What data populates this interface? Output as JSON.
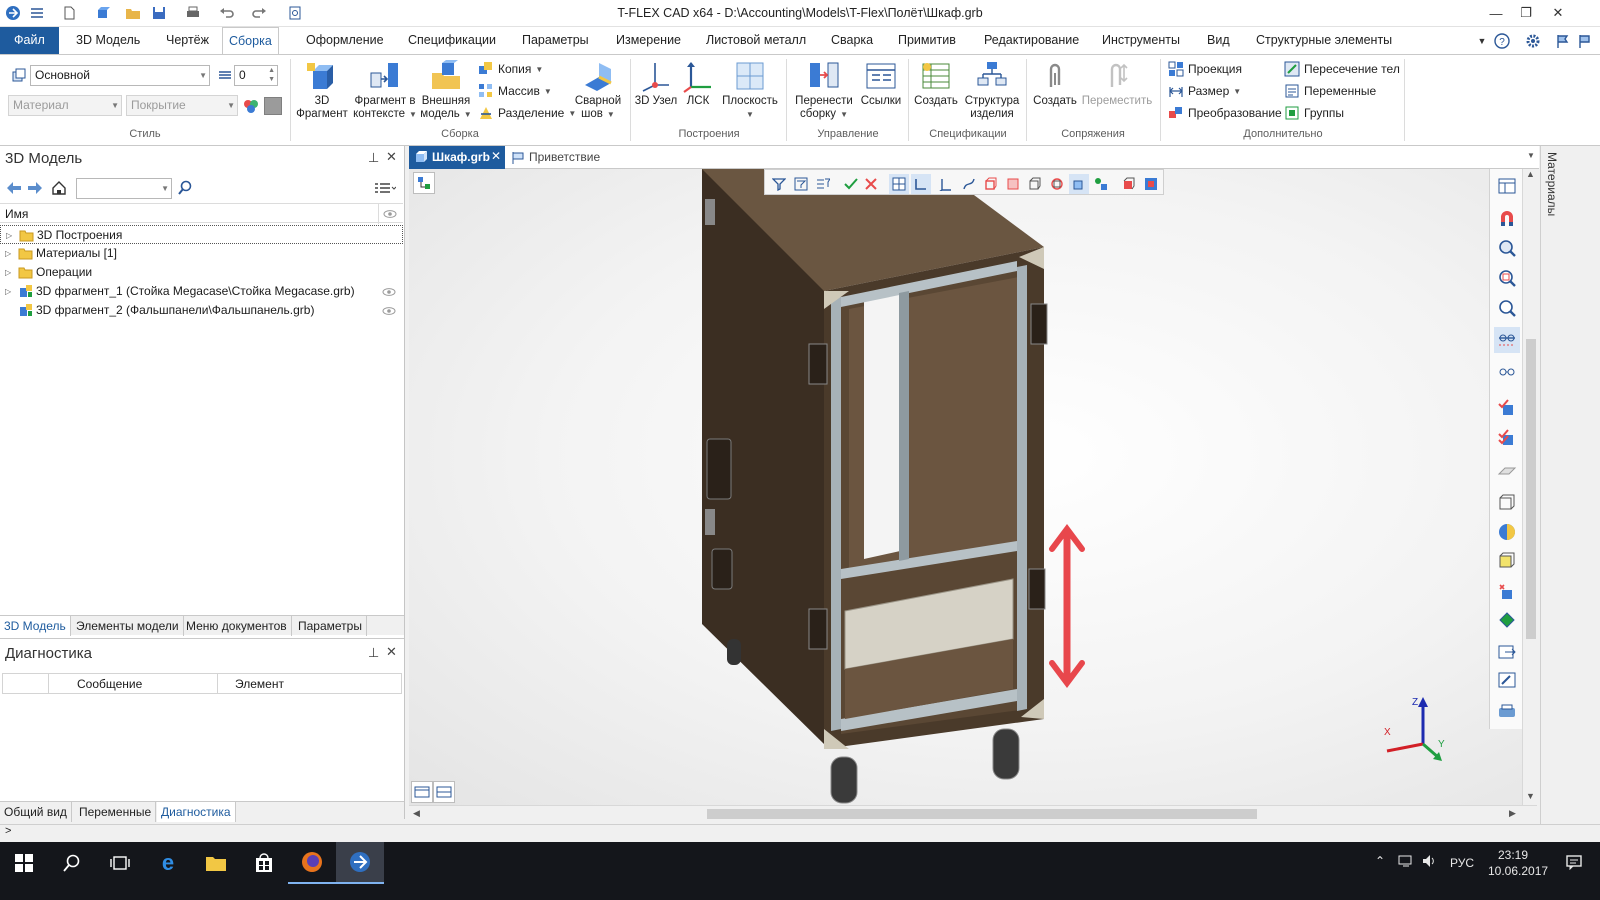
{
  "window": {
    "title": "T-FLEX CAD x64 - D:\\Accounting\\Models\\T-Flex\\Полёт\\Шкаф.grb"
  },
  "menu": {
    "tabs": [
      {
        "label": "Файл"
      },
      {
        "label": "3D Модель"
      },
      {
        "label": "Чертёж"
      },
      {
        "label": "Сборка"
      },
      {
        "label": "Оформление"
      },
      {
        "label": "Спецификации"
      },
      {
        "label": "Параметры"
      },
      {
        "label": "Измерение"
      },
      {
        "label": "Листовой металл"
      },
      {
        "label": "Сварка"
      },
      {
        "label": "Примитив"
      },
      {
        "label": "Редактирование"
      },
      {
        "label": "Инструменты"
      },
      {
        "label": "Вид"
      },
      {
        "label": "Структурные элементы"
      }
    ],
    "active": "Сборка"
  },
  "ribbon": {
    "style": {
      "layer_value": "Основной",
      "priority_value": "0",
      "material_placeholder": "Материал",
      "coating_placeholder": "Покрытие",
      "group_label": "Стиль"
    },
    "assembly": {
      "fragment3d": "3D Фрагмент",
      "fragment_in_context": "Фрагмент в контексте",
      "external_model": "Внешняя модель",
      "copy": "Копия",
      "array": "Массив",
      "split": "Разделение",
      "weld_seam": "Сварной шов",
      "group_label": "Сборка"
    },
    "constructions": {
      "node3d": "3D Узел",
      "lcs": "ЛСК",
      "planes": "Плоскость",
      "group_label": "Построения"
    },
    "management": {
      "move_to_assembly": "Перенести сборку",
      "links": "Ссылки",
      "group_label": "Управление"
    },
    "specs": {
      "create": "Создать",
      "product_structure": "Структура изделия",
      "group_label": "Спецификации"
    },
    "mates": {
      "create": "Создать",
      "move": "Переместить",
      "group_label": "Сопряжения"
    },
    "additional": {
      "projection": "Проекция",
      "dimension": "Размер",
      "transformation": "Преобразование",
      "body_intersection": "Пересечение тел",
      "variables": "Переменные",
      "groups": "Группы",
      "group_label": "Дополнительно"
    }
  },
  "left_panel": {
    "title": "3D Модель",
    "search_value": "",
    "column_name": "Имя",
    "tree": [
      {
        "label": "3D Построения",
        "icon": "folder-icon",
        "expandable": true
      },
      {
        "label": "Материалы [1]",
        "icon": "folder-icon",
        "expandable": true
      },
      {
        "label": "Операции",
        "icon": "folder-icon",
        "expandable": true
      },
      {
        "label": "3D фрагмент_1 (Стойка Megacase\\Стойка Megacase.grb)",
        "icon": "fragment-icon",
        "expandable": true,
        "visible": true
      },
      {
        "label": "3D фрагмент_2 (Фальшпанели\\Фальшпанель.grb)",
        "icon": "fragment-icon",
        "expandable": false,
        "visible": true
      }
    ],
    "tabs": [
      "3D Модель",
      "Элементы модели",
      "Меню документов",
      "Параметры"
    ],
    "active_tab": "3D Модель"
  },
  "diagnostics": {
    "title": "Диагностика",
    "columns": [
      "",
      "Сообщение",
      "Элемент"
    ],
    "bottom_tabs": [
      "Общий вид",
      "Переменные",
      "Диагностика"
    ],
    "active_tab": "Диагностика"
  },
  "documents": {
    "tabs": [
      {
        "label": "Шкаф.grb",
        "active": true
      },
      {
        "label": "Приветствие",
        "active": false
      }
    ]
  },
  "viewport": {
    "axes": {
      "x": "X",
      "y": "Y",
      "z": "Z"
    },
    "colors": {
      "cabinet": "#4a3a2a",
      "rack": "#a7b2b8",
      "arrow": "#e8474c",
      "panel": "#d6d2c6"
    }
  },
  "side_tab": {
    "label": "Материалы"
  },
  "command_line": {
    "prompt": ">"
  },
  "taskbar": {
    "language": "РУС",
    "time": "23:19",
    "date": "10.06.2017"
  },
  "colors": {
    "accent": "#1e5b9e",
    "taskbar": "#14161b"
  }
}
